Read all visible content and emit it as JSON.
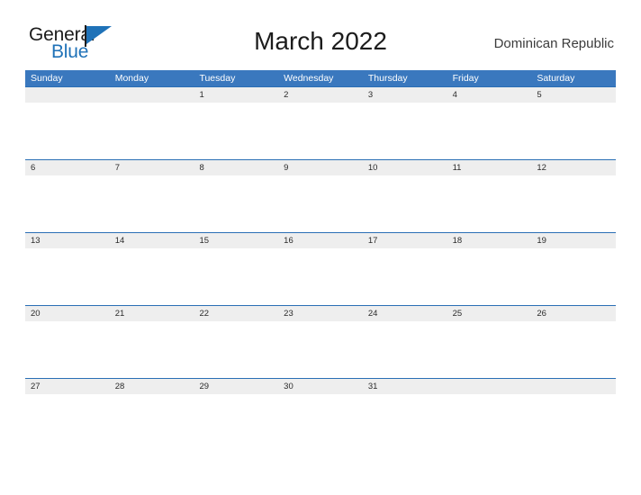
{
  "logo": {
    "word_one": "General",
    "word_two": "Blue",
    "flag_icon": "blue-flag-triangle"
  },
  "header": {
    "title": "March 2022",
    "country": "Dominican Republic"
  },
  "colors": {
    "header_blue": "#3a78be",
    "row_divider_blue": "#2a6fb5",
    "date_strip_gray": "#eeeeee",
    "logo_blue": "#1f72b8",
    "page_background": "#ffffff",
    "text_dark": "#1c1c1c"
  },
  "calendar": {
    "month": "March",
    "year": "2022",
    "weekday_headers": [
      "Sunday",
      "Monday",
      "Tuesday",
      "Wednesday",
      "Thursday",
      "Friday",
      "Saturday"
    ],
    "weeks": [
      [
        "",
        "",
        "1",
        "2",
        "3",
        "4",
        "5"
      ],
      [
        "6",
        "7",
        "8",
        "9",
        "10",
        "11",
        "12"
      ],
      [
        "13",
        "14",
        "15",
        "16",
        "17",
        "18",
        "19"
      ],
      [
        "20",
        "21",
        "22",
        "23",
        "24",
        "25",
        "26"
      ],
      [
        "27",
        "28",
        "29",
        "30",
        "31",
        "",
        ""
      ]
    ]
  }
}
